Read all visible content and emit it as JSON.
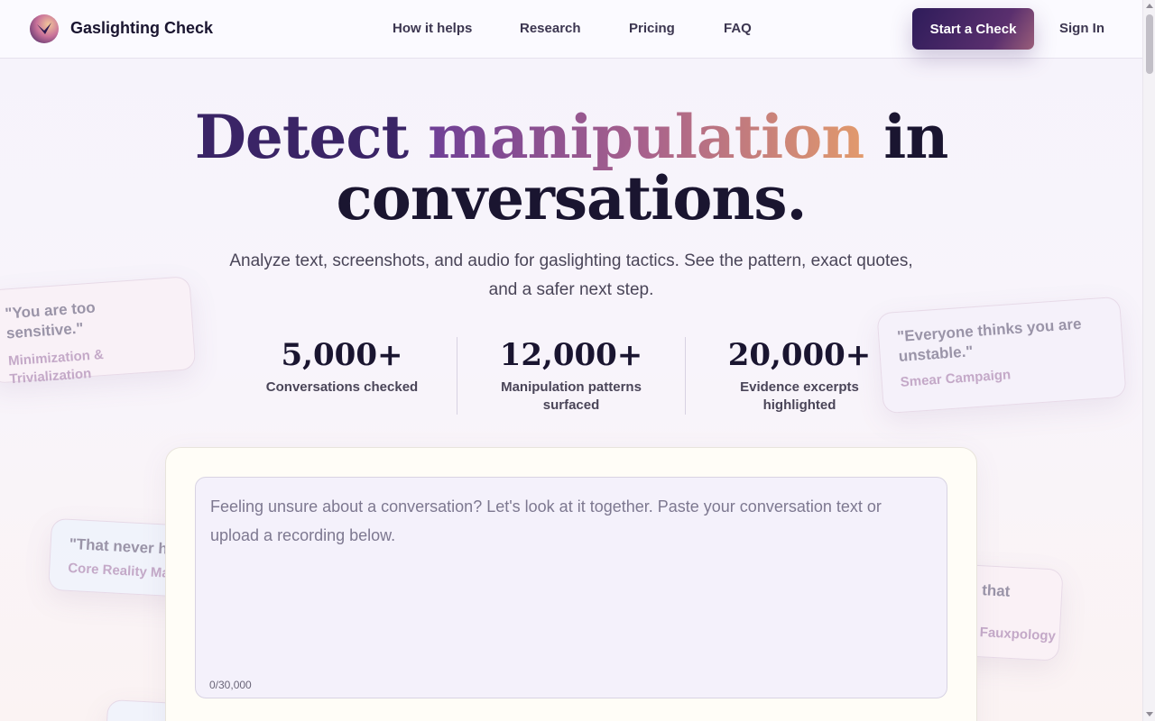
{
  "header": {
    "brand": "Gaslighting Check",
    "nav": [
      "How it helps",
      "Research",
      "Pricing",
      "FAQ"
    ],
    "cta": "Start a Check",
    "sign_in": "Sign In"
  },
  "hero": {
    "title_word1": "Detect",
    "title_word2": "manipulation",
    "title_word3": "in",
    "title_line2": "conversations.",
    "subtitle": "Analyze text, screenshots, and audio for gaslighting tactics. See the pattern, exact quotes, and a safer next step."
  },
  "stats": [
    {
      "value": "5,000+",
      "label": "Conversations checked"
    },
    {
      "value": "12,000+",
      "label": "Manipulation patterns surfaced"
    },
    {
      "value": "20,000+",
      "label": "Evidence excerpts highlighted"
    }
  ],
  "quote_cards": [
    {
      "quote": "\"You are too sensitive.\"",
      "tag": "Minimization & Trivialization"
    },
    {
      "quote": "\"Everyone thinks you are unstable.\"",
      "tag": "Smear Campaign"
    },
    {
      "quote": "\"That never h",
      "tag": "Core Reality Ma"
    },
    {
      "quote": "that",
      "tag": "Fauxpology"
    }
  ],
  "analyzer": {
    "placeholder": "Feeling unsure about a conversation? Let's look at it together. Paste your conversation text or upload a recording below.",
    "counter": "0/30,000"
  },
  "colors": {
    "brand_dark": "#2e1c5a",
    "accent_gradient_start": "#6e3f96",
    "accent_gradient_end": "#e29a6c"
  }
}
